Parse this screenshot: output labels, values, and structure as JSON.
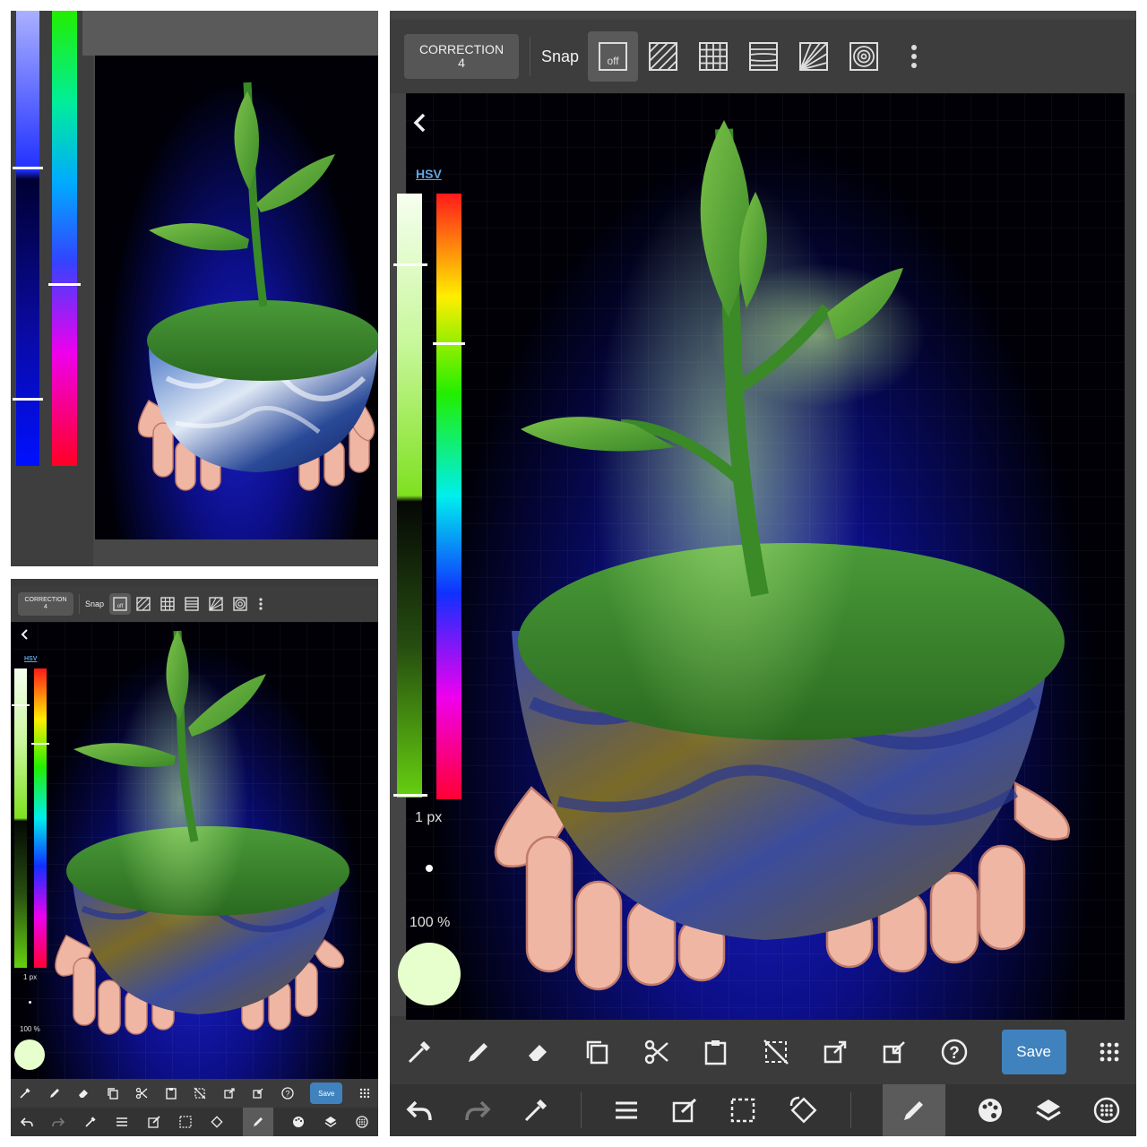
{
  "panel_a": {
    "hue_slider_handle": 0.51,
    "value_slider_handle": 0.38
  },
  "toolbar": {
    "correction_label": "CORRECTION",
    "correction_value": "4",
    "snap_label": "Snap",
    "snap_off_label": "off",
    "snap_modes": [
      "snap-off-icon",
      "parallel-lines-icon",
      "grid-icon",
      "horizontal-lines-icon",
      "radial-lines-icon",
      "concentric-circles-icon"
    ],
    "more_icon": "more-vertical-icon"
  },
  "color_panel": {
    "back_icon": "chevron-left-icon",
    "mode_label": "HSV",
    "brush_size": "1 px",
    "opacity": "100 %",
    "current_color": "#e6ffcc",
    "hue_handle": 0.25,
    "value_handle": 0.12
  },
  "bottom_toolbar": {
    "save_label": "Save",
    "tools": [
      "eyedropper-icon",
      "pen-icon",
      "eraser-icon",
      "copy-icon",
      "cut-icon",
      "paste-icon",
      "deselect-icon",
      "export-icon",
      "import-icon",
      "help-icon",
      "save-button",
      "grid-menu-icon"
    ]
  },
  "nav_bar": {
    "tools": [
      "undo-icon",
      "redo-icon",
      "eyedropper-icon",
      "menu-icon",
      "edit-icon",
      "selection-icon",
      "rotate-icon",
      "brush-icon",
      "palette-icon",
      "layers-icon",
      "settings-icon"
    ],
    "active": "brush-icon"
  },
  "colors": {
    "accent": "#3f82be",
    "toolbar_bg": "#3b3b3b",
    "canvas_bg": "#000006",
    "glow_blue": "#1a1fc4"
  }
}
